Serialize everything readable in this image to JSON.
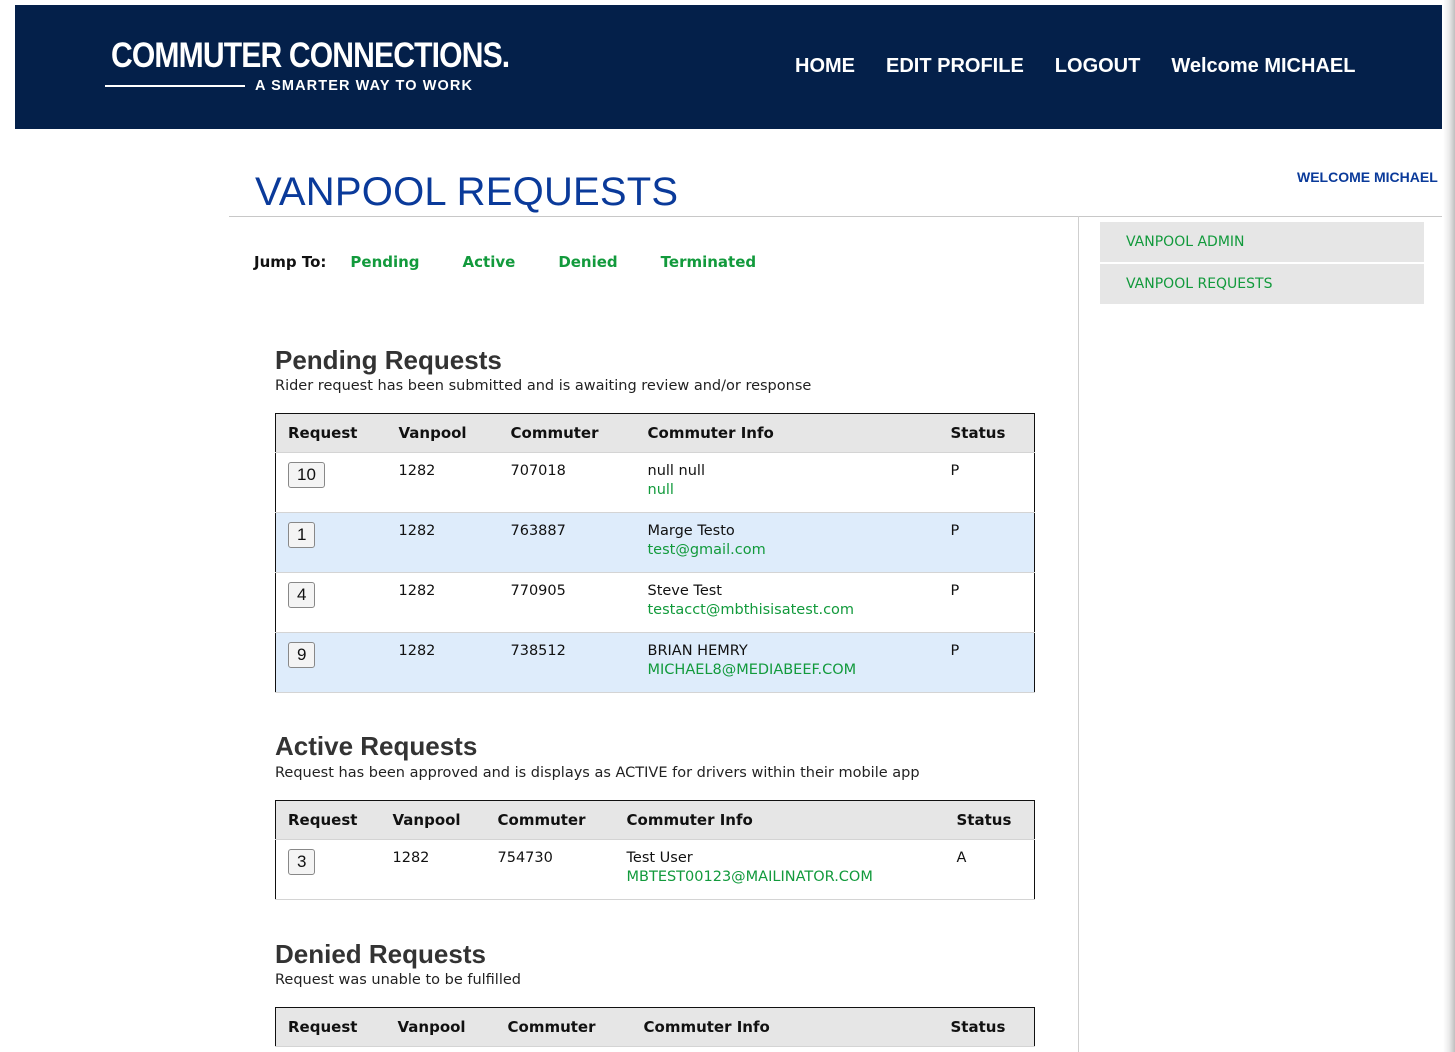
{
  "header": {
    "logo_text": "COMMUTER CONNECTIONS.",
    "logo_tagline": "A SMARTER WAY TO WORK",
    "nav": {
      "home": "HOME",
      "edit_profile": "EDIT PROFILE",
      "logout": "LOGOUT",
      "welcome": "Welcome MICHAEL"
    },
    "bg_color": "#04204a"
  },
  "page_title": "VANPOOL REQUESTS",
  "welcome_right": "WELCOME MICHAEL",
  "sidebar": {
    "items": [
      {
        "label": "VANPOOL ADMIN"
      },
      {
        "label": "VANPOOL REQUESTS"
      }
    ]
  },
  "jump": {
    "label": "Jump To:",
    "links": [
      "Pending",
      "Active",
      "Denied",
      "Terminated"
    ]
  },
  "sections": {
    "pending": {
      "title": "Pending Requests",
      "description": "Rider request has been submitted and is awaiting review and/or response",
      "columns": [
        "Request",
        "Vanpool",
        "Commuter",
        "Commuter Info",
        "Status"
      ],
      "rows": [
        {
          "request": "10",
          "vanpool": "1282",
          "commuter": "707018",
          "name": "null null",
          "email": "null",
          "status": "P"
        },
        {
          "request": "1",
          "vanpool": "1282",
          "commuter": "763887",
          "name": "Marge Testo",
          "email": "test@gmail.com",
          "status": "P"
        },
        {
          "request": "4",
          "vanpool": "1282",
          "commuter": "770905",
          "name": "Steve Test",
          "email": "testacct@mbthisisatest.com",
          "status": "P"
        },
        {
          "request": "9",
          "vanpool": "1282",
          "commuter": "738512",
          "name": "BRIAN HEMRY",
          "email": "MICHAEL8@MEDIABEEF.COM",
          "status": "P"
        }
      ]
    },
    "active": {
      "title": "Active Requests",
      "description": "Request has been approved and is displays as ACTIVE for drivers within their mobile app",
      "columns": [
        "Request",
        "Vanpool",
        "Commuter",
        "Commuter Info",
        "Status"
      ],
      "rows": [
        {
          "request": "3",
          "vanpool": "1282",
          "commuter": "754730",
          "name": "Test User",
          "email": "MBTEST00123@MAILINATOR.COM",
          "status": "A"
        }
      ]
    },
    "denied": {
      "title": "Denied Requests",
      "description": "Request was unable to be fulfilled",
      "columns": [
        "Request",
        "Vanpool",
        "Commuter",
        "Commuter Info",
        "Status"
      ],
      "rows": []
    }
  },
  "colors": {
    "link_green": "#129a3c",
    "title_blue": "#0a3a9a",
    "row_alt": "#deecfb"
  }
}
